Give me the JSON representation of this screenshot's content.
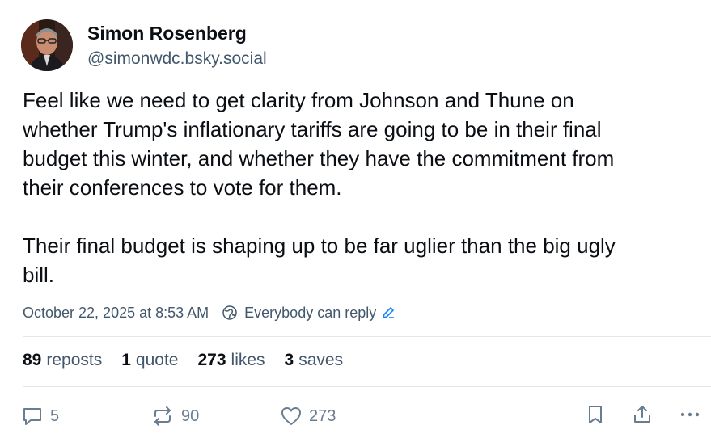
{
  "author": {
    "display_name": "Simon Rosenberg",
    "handle": "@simonwdc.bsky.social"
  },
  "post": {
    "paragraph1": [
      "Feel like we need to get clarity from Johnson and Thune on",
      "whether Trump's inflationary tariffs are going to be in their final",
      "budget this winter, and whether they have the commitment from",
      "their conferences to vote for them."
    ],
    "paragraph2": [
      "Their final budget is shaping up to be far uglier than the big ugly",
      "bill."
    ]
  },
  "meta": {
    "timestamp": "October 22, 2025 at 8:53 AM",
    "reply_setting": "Everybody can reply"
  },
  "stats": {
    "reposts_count": "89",
    "reposts_label": "reposts",
    "quotes_count": "1",
    "quotes_label": "quote",
    "likes_count": "273",
    "likes_label": "likes",
    "saves_count": "3",
    "saves_label": "saves"
  },
  "actions": {
    "reply_count": "5",
    "repost_count": "90",
    "like_count": "273",
    "icons": [
      "reply-icon",
      "repost-icon",
      "heart-icon",
      "bookmark-icon",
      "share-icon",
      "more-icon"
    ]
  },
  "colors": {
    "text": "#0b0f14",
    "muted": "#42576c",
    "action": "#6a7d90",
    "link": "#1083fe",
    "divider": "#e2e7ee"
  }
}
